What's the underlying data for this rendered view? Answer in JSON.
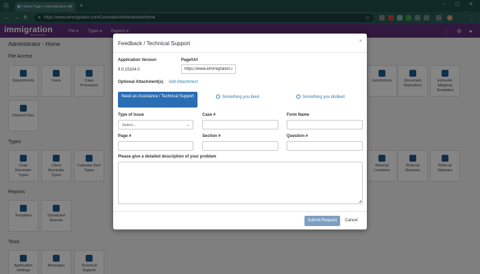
{
  "browser": {
    "tab_title": "Home Page | eimmigration by",
    "url": "https://www.eimmigration.com/Cerenade/Administrator/Home"
  },
  "app": {
    "logo": "immigration",
    "logo_sub": "by cerenade",
    "menu": [
      "File ▾",
      "Types ▾",
      "Reports ▾"
    ]
  },
  "page": {
    "title": "Administrator - Home",
    "sections": {
      "file_access": "File Access",
      "types": "Types",
      "reports": "Reports",
      "tools": "Tools"
    },
    "file_tiles": [
      "Departments",
      "Users",
      "Case Processes",
      "Jurisdictions",
      "Document Repository",
      "Extractor Mapping Templates",
      "Deleted Files"
    ],
    "type_tiles": [
      "Case Reminder Types",
      "Client Reminder Types",
      "Calendar Item Types",
      "Referral Locations",
      "Referral Reasons",
      "Referral Statuses"
    ],
    "report_tiles": [
      "Templates",
      "Scheduled Reports"
    ],
    "tool_tiles": [
      "Application Settings",
      "Messages",
      "Technical Support"
    ]
  },
  "modal": {
    "title": "Feedback / Technical Support",
    "close": "×",
    "app_version_label": "Application Version",
    "app_version_value": "9.0.15104.0",
    "page_url_label": "Page/Url",
    "page_url_value": "https://www.eimmigration.com/Cerenade/Administrator/Home",
    "attachment_label": "Optional Attachment(s)",
    "add_attachment": "Add Attachment",
    "tabs": {
      "assistance": "Need an Assistance / Technical Support",
      "liked": "Something you liked",
      "disliked": "Something you disliked"
    },
    "fields": {
      "type_of_issue": "Type of Issue",
      "type_of_issue_value": "Select...",
      "case_no": "Case #",
      "form_name": "Form Name",
      "page_no": "Page #",
      "section_no": "Section #",
      "question_no": "Question #",
      "description": "Please give a detailed description of your problem"
    },
    "submit": "Submit Request",
    "cancel": "Cancel"
  },
  "colors": {
    "primary": "#2a6db3",
    "header": "#5e2f78",
    "browser": "#1f4d49"
  }
}
